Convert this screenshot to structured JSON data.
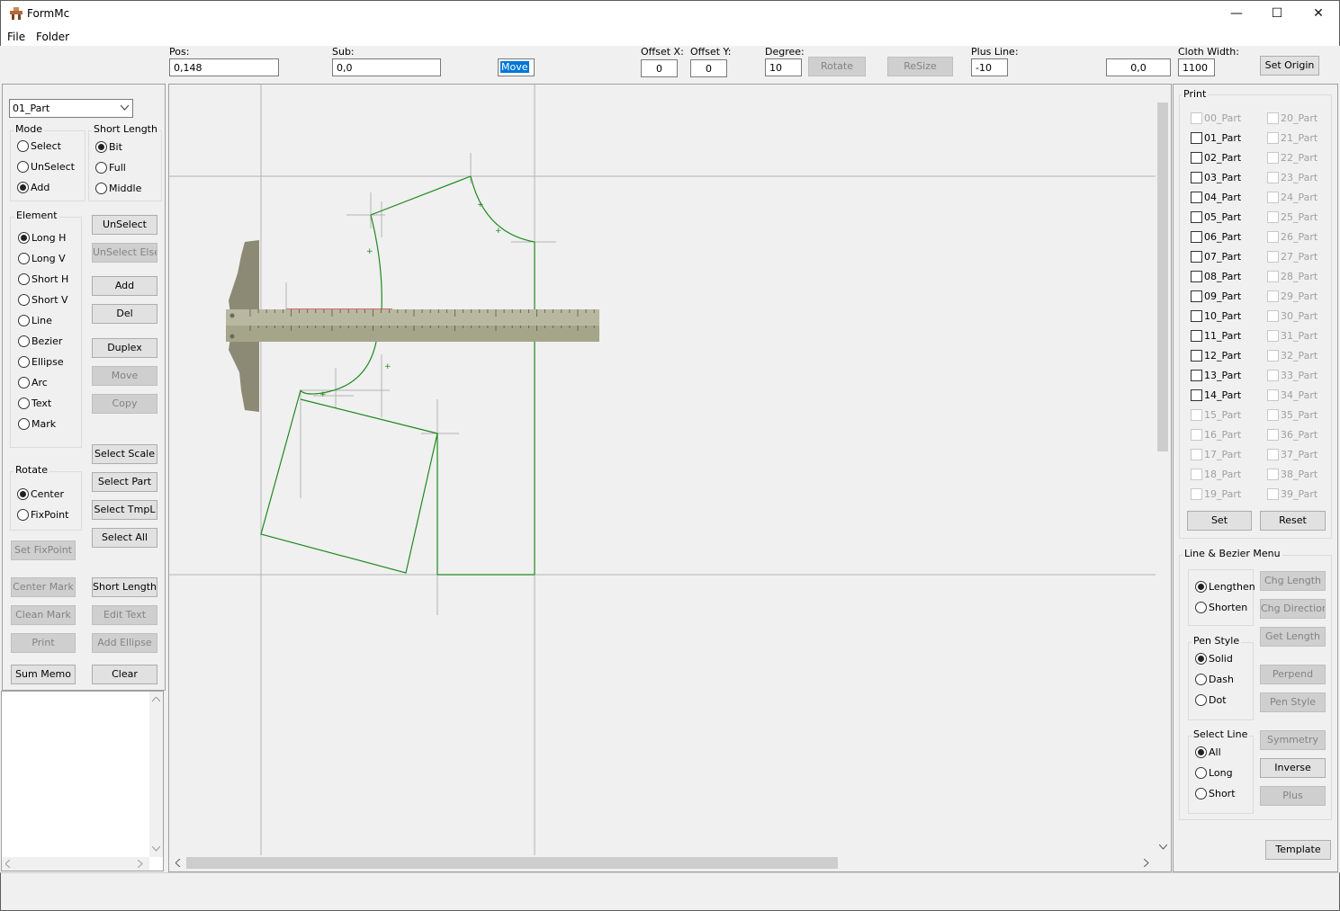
{
  "window": {
    "title": "FormMc",
    "minimize": "—",
    "maximize": "☐",
    "close": "✕"
  },
  "menu": {
    "file": "File",
    "folder": "Folder"
  },
  "toolbar": {
    "pos_label": "Pos:",
    "pos_value": "0,148",
    "sub_label": "Sub:",
    "sub_value": "0,0",
    "move_value": "Move",
    "offset_x_label": "Offset X:",
    "offset_x_value": "0",
    "offset_y_label": "Offset Y:",
    "offset_y_value": "0",
    "degree_label": "Degree:",
    "degree_value": "10",
    "rotate_btn": "Rotate",
    "resize_btn": "ReSize",
    "plus_line_label": "Plus Line:",
    "plus_line_value": "-10",
    "coord_value": "0,0",
    "cloth_width_label": "Cloth Width:",
    "cloth_width_value": "1100",
    "set_origin_btn": "Set Origin"
  },
  "left": {
    "part_select": "01_Part",
    "mode": {
      "label": "Mode",
      "options": [
        "Select",
        "UnSelect",
        "Add"
      ],
      "selected": "Add"
    },
    "short_length": {
      "label": "Short Length",
      "options": [
        "Bit",
        "Full",
        "Middle"
      ],
      "selected": "Bit"
    },
    "element": {
      "label": "Element",
      "options": [
        "Long H",
        "Long V",
        "Short H",
        "Short V",
        "Line",
        "Bezier",
        "Ellipse",
        "Arc",
        "Text",
        "Mark"
      ],
      "selected": "Long H"
    },
    "rotate": {
      "label": "Rotate",
      "options": [
        "Center",
        "FixPoint"
      ],
      "selected": "Center"
    },
    "buttons": {
      "unselect": "UnSelect",
      "unselect_else": "UnSelect Else",
      "add": "Add",
      "del": "Del",
      "duplex": "Duplex",
      "move": "Move",
      "copy": "Copy",
      "select_scale": "Select Scale",
      "select_part": "Select Part",
      "select_tmpl": "Select TmpL",
      "select_all": "Select All",
      "set_fixpoint": "Set FixPoint",
      "center_mark": "Center Mark",
      "short_length": "Short Length",
      "clean_mark": "Clean Mark",
      "edit_text": "Edit Text",
      "print": "Print",
      "add_ellipse": "Add Ellipse",
      "sum_memo": "Sum Memo",
      "clear": "Clear"
    }
  },
  "print_panel": {
    "label": "Print",
    "parts_left": [
      "00_Part",
      "01_Part",
      "02_Part",
      "03_Part",
      "04_Part",
      "05_Part",
      "06_Part",
      "07_Part",
      "08_Part",
      "09_Part",
      "10_Part",
      "11_Part",
      "12_Part",
      "13_Part",
      "14_Part",
      "15_Part",
      "16_Part",
      "17_Part",
      "18_Part",
      "19_Part"
    ],
    "parts_right": [
      "20_Part",
      "21_Part",
      "22_Part",
      "23_Part",
      "24_Part",
      "25_Part",
      "26_Part",
      "27_Part",
      "28_Part",
      "29_Part",
      "30_Part",
      "31_Part",
      "32_Part",
      "33_Part",
      "34_Part",
      "35_Part",
      "36_Part",
      "37_Part",
      "38_Part",
      "39_Part"
    ],
    "set_btn": "Set",
    "reset_btn": "Reset"
  },
  "line_menu": {
    "label": "Line & Bezier Menu",
    "length_options": [
      "Lengthen",
      "Shorten"
    ],
    "length_selected": "Lengthen",
    "pen_style": {
      "label": "Pen Style",
      "options": [
        "Solid",
        "Dash",
        "Dot"
      ],
      "selected": "Solid"
    },
    "select_line": {
      "label": "Select Line",
      "options": [
        "All",
        "Long",
        "Short"
      ],
      "selected": "All"
    },
    "buttons": {
      "chg_length": "Chg Length",
      "chg_direction": "Chg Direction",
      "get_length": "Get Length",
      "perpend": "Perpend",
      "pen_style": "Pen Style",
      "symmetry": "Symmetry",
      "inverse": "Inverse",
      "plus": "Plus"
    },
    "template_btn": "Template"
  },
  "colors": {
    "pattern_line": "#1f8a1f",
    "ruler": "#b8b8a0",
    "ruler_dark": "#8f8f76",
    "handle": "#8c8a74",
    "accent": "#0078d7"
  }
}
